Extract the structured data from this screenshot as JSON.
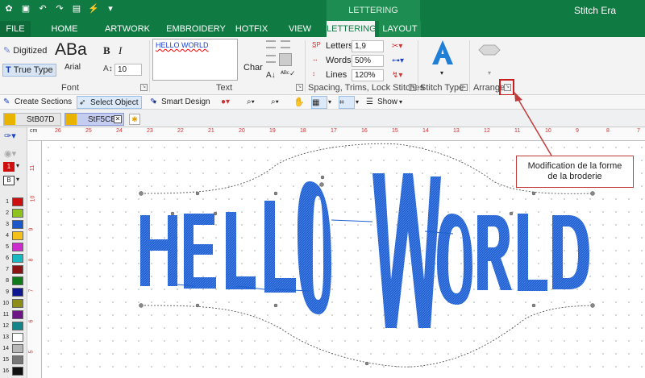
{
  "app_title": "Stitch Era",
  "contextual_tab_header": "LETTERING",
  "tabs": [
    {
      "label": "FILE"
    },
    {
      "label": "HOME"
    },
    {
      "label": "ARTWORK"
    },
    {
      "label": "EMBROIDERY"
    },
    {
      "label": "HOTFIX"
    },
    {
      "label": "VIEW"
    },
    {
      "label": "LETTERING"
    },
    {
      "label": "LAYOUT"
    }
  ],
  "ribbon": {
    "font": {
      "digitized_label": "Digitized",
      "truetype_label": "True Type",
      "preview_text": "ABa",
      "font_name": "Arial",
      "bold": "B",
      "italic": "I",
      "size_value": "10",
      "group_label": "Font"
    },
    "text": {
      "content": "HELLO WORLD",
      "char_label": "Char",
      "group_label": "Text"
    },
    "spacing": {
      "letters_label": "Letters",
      "letters_value": "1,9",
      "words_label": "Words",
      "words_value": "50%",
      "lines_label": "Lines",
      "lines_value": "120%",
      "group_label": "Spacing, Trims, Lock Stitches"
    },
    "stitch_type": {
      "group_label": "Stitch Type"
    },
    "arrange": {
      "group_label": "Arrange"
    }
  },
  "toolbar": {
    "create_sections": "Create Sections",
    "select_object": "Select Object",
    "smart_design": "Smart Design",
    "show": "Show"
  },
  "doc_tabs": [
    {
      "label": "StB07D"
    },
    {
      "label": "StF5CB",
      "close": "✕"
    }
  ],
  "palette": [
    {
      "num": "1",
      "color": "#cc1010"
    },
    {
      "num": "2",
      "color": "#8fc31f"
    },
    {
      "num": "3",
      "color": "#1c57c9"
    },
    {
      "num": "4",
      "color": "#f2c21b"
    },
    {
      "num": "5",
      "color": "#cc2ccc"
    },
    {
      "num": "6",
      "color": "#18b9c0"
    },
    {
      "num": "7",
      "color": "#8a1414"
    },
    {
      "num": "8",
      "color": "#0f7a1c"
    },
    {
      "num": "9",
      "color": "#0d1890"
    },
    {
      "num": "10",
      "color": "#8d8d1a"
    },
    {
      "num": "11",
      "color": "#6c1584"
    },
    {
      "num": "12",
      "color": "#13848a"
    },
    {
      "num": "13",
      "color": "#ffffff"
    },
    {
      "num": "14",
      "color": "#b8b8b8"
    },
    {
      "num": "15",
      "color": "#777777"
    },
    {
      "num": "16",
      "color": "#111111"
    }
  ],
  "left_tools": {
    "color_index": "1",
    "b_label": "B"
  },
  "hruler_labels": [
    "cm",
    "26",
    "25",
    "24",
    "23",
    "22",
    "21",
    "20",
    "19",
    "18",
    "17",
    "16",
    "15",
    "14",
    "13",
    "12",
    "11",
    "10",
    "9",
    "8",
    "7"
  ],
  "vruler_labels": [
    "11",
    "10",
    "9",
    "8",
    "7",
    "6",
    "5"
  ],
  "design_text": "HELLO WORLD",
  "annotation": {
    "text_line1": "Modification de la forme",
    "text_line2": "de la broderie"
  },
  "colors": {
    "ribbon_green": "#107a43",
    "stitch_blue": "#1e5fd0",
    "annotation_red": "#c23b3b"
  }
}
